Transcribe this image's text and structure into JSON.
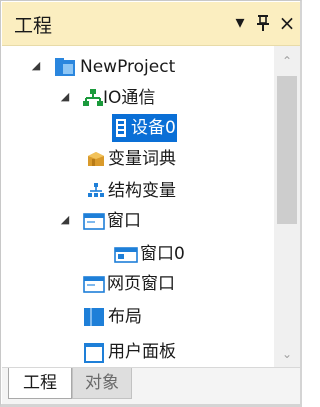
{
  "panel": {
    "title": "工程",
    "dropdown_glyph": "▾",
    "pin_glyph": "ᚹ",
    "close_glyph": "×"
  },
  "tree": {
    "items": [
      {
        "label": "NewProject",
        "icon": "project-icon",
        "expander": "◢",
        "expanded": true
      },
      {
        "label": "IO通信",
        "icon": "io-network-icon",
        "expander": "◢",
        "expanded": true
      },
      {
        "label": "设备0",
        "icon": "device-icon",
        "selected": true
      },
      {
        "label": "变量词典",
        "icon": "dictionary-icon"
      },
      {
        "label": "结构变量",
        "icon": "struct-variable-icon"
      },
      {
        "label": "窗口",
        "icon": "window-icon",
        "expander": "◢",
        "expanded": true
      },
      {
        "label": "窗口0",
        "icon": "window-item-icon"
      },
      {
        "label": "网页窗口",
        "icon": "web-window-icon"
      },
      {
        "label": "布局",
        "icon": "layout-icon"
      },
      {
        "label": "用户面板",
        "icon": "user-panel-icon"
      }
    ]
  },
  "scrollbar": {
    "up_glyph": "⌃",
    "down_glyph": "⌄"
  },
  "tabs": [
    {
      "label": "工程",
      "active": true
    },
    {
      "label": "对象",
      "active": false
    }
  ],
  "colors": {
    "title_bar": "#fbeec0",
    "selection": "#0a6fd6",
    "icon_blue": "#1e7fd8"
  }
}
